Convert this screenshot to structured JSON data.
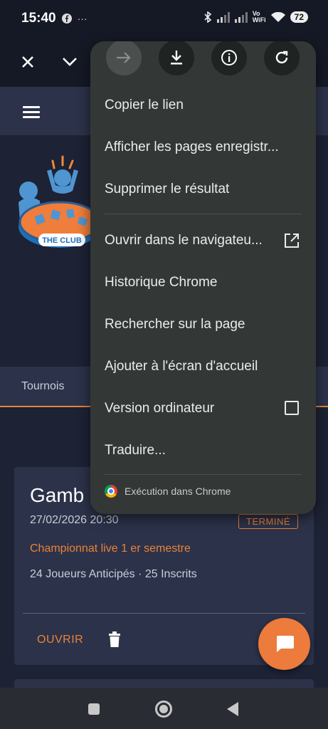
{
  "status_bar": {
    "time": "15:40",
    "battery": "72",
    "vowifi_top": "Vo",
    "vowifi_bottom": "WiFi"
  },
  "toolbar": {
    "close_icon": "close-icon",
    "expand_icon": "chevron-down-icon"
  },
  "hero": {
    "logo_text": "THE CLUB"
  },
  "tabs": {
    "tournois": "Tournois"
  },
  "card": {
    "title": "Gamb",
    "date": "27/02/2026 20:30",
    "badge": "TERMINÉ",
    "championship": "Championnat live 1 er semestre",
    "players": "24 Joueurs Anticipés · 25 Inscrits",
    "open_label": "OUVRIR"
  },
  "menu": {
    "top_icons": [
      "forward-icon",
      "download-icon",
      "info-icon",
      "refresh-icon"
    ],
    "items": [
      "Copier le lien",
      "Afficher les pages enregistr...",
      "Supprimer le résultat",
      "Ouvrir dans le navigateu...",
      "Historique Chrome",
      "Rechercher sur la page",
      "Ajouter à l'écran d'accueil",
      "Version ordinateur",
      "Traduire..."
    ],
    "footer": "Exécution dans Chrome"
  },
  "colors": {
    "accent": "#e9833a",
    "menu_bg": "#333837",
    "page_bg": "#1d2234",
    "header_bg": "#2c3249"
  }
}
